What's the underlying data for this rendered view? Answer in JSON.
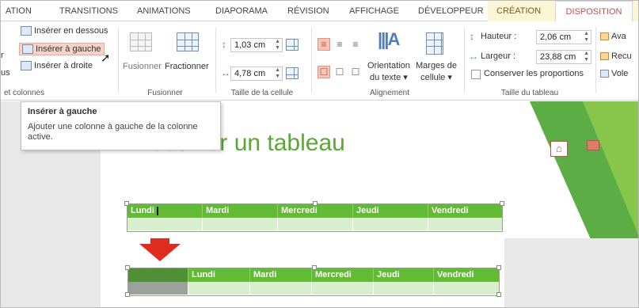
{
  "tabs": [
    {
      "label": "ATION"
    },
    {
      "label": "TRANSITIONS"
    },
    {
      "label": "ANIMATIONS"
    },
    {
      "label": "DIAPORAMA"
    },
    {
      "label": "RÉVISION"
    },
    {
      "label": "AFFICHAGE"
    },
    {
      "label": "DÉVELOPPEUR"
    },
    {
      "label": "CRÉATION"
    },
    {
      "label": "DISPOSITION"
    }
  ],
  "ribbon": {
    "rows_cols": {
      "insert_below": "Insérer en dessous",
      "insert_left": "Insérer à gauche",
      "insert_right": "Insérer à droite",
      "partial_r": "r",
      "partial_us": "us",
      "group_label": "et colonnes"
    },
    "merge": {
      "merge_label": "Fusionner",
      "split_label": "Fractionner",
      "group_label": "Fusionner"
    },
    "cell_size": {
      "height_value": "1,03 cm",
      "width_value": "4,78 cm",
      "group_label": "Taille de la cellule"
    },
    "alignment": {
      "text_direction_l1": "Orientation",
      "text_direction_l2": "du texte ▾",
      "margins_l1": "Marges de",
      "margins_l2": "cellule ▾",
      "group_label": "Alignement"
    },
    "table_size": {
      "height_label": "Hauteur :",
      "height_value": "2,06 cm",
      "width_label": "Largeur :",
      "width_value": "23,88 cm",
      "lock_label": "Conserver les proportions",
      "group_label": "Taille du tableau"
    },
    "arrange": {
      "forward": "Ava",
      "backward": "Recu",
      "pane": "Vole"
    }
  },
  "tooltip": {
    "title": "Insérer à gauche",
    "desc_l1": "Ajouter une colonne à gauche de la colonne",
    "desc_l2": "active."
  },
  "slide": {
    "title": "Dessiner un tableau",
    "table1": {
      "headers": [
        "Lundi",
        "Mardi",
        "Mercredi",
        "Jeudi",
        "Vendredi"
      ]
    },
    "table2": {
      "headers": [
        "",
        "Lundi",
        "Mardi",
        "Mercredi",
        "Jeudi",
        "Vendredi"
      ]
    }
  },
  "colors": {
    "accent": "#c0504d",
    "table_header": "#62bb35",
    "table_body": "#d9eecd",
    "new_column_header": "#4f8f35",
    "new_column_body": "#9aa39a",
    "arrow": "#e02b1f"
  }
}
